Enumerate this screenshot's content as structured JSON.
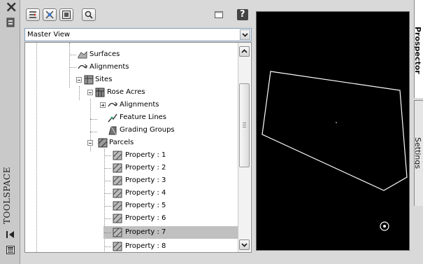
{
  "palette": {
    "title": "TOOLSPACE"
  },
  "toolbar": {
    "buttons": [
      "toggle-display-icon",
      "item-view-icon",
      "settings-view-icon",
      "search-icon"
    ],
    "right_icons": [
      "panel-icon",
      "help-icon"
    ],
    "help_label": "?"
  },
  "view_select": {
    "value": "Master View"
  },
  "tree": {
    "items": [
      {
        "label": "Surfaces",
        "icon": "surfaces-icon"
      },
      {
        "label": "Alignments",
        "icon": "alignments-icon"
      },
      {
        "label": "Sites",
        "icon": "sites-icon"
      },
      {
        "label": "Rose Acres",
        "icon": "site-icon"
      },
      {
        "label": "Alignments",
        "icon": "alignments-icon"
      },
      {
        "label": "Feature Lines",
        "icon": "feature-lines-icon"
      },
      {
        "label": "Grading Groups",
        "icon": "grading-groups-icon"
      },
      {
        "label": "Parcels",
        "icon": "parcels-icon"
      },
      {
        "label": "Property : 1",
        "icon": "parcel-icon"
      },
      {
        "label": "Property : 2",
        "icon": "parcel-icon"
      },
      {
        "label": "Property : 3",
        "icon": "parcel-icon"
      },
      {
        "label": "Property : 4",
        "icon": "parcel-icon"
      },
      {
        "label": "Property : 5",
        "icon": "parcel-icon"
      },
      {
        "label": "Property : 6",
        "icon": "parcel-icon"
      },
      {
        "label": "Property : 7",
        "icon": "parcel-icon"
      },
      {
        "label": "Property : 8",
        "icon": "parcel-icon"
      }
    ],
    "selected": "Property : 7"
  },
  "tabs": [
    {
      "label": "Prospector",
      "active": true
    },
    {
      "label": "Settings",
      "active": false
    }
  ],
  "colors": {
    "preview_bg": "#000000",
    "parcel_outline": "#ffffff",
    "selection": "#c0c0c0"
  }
}
